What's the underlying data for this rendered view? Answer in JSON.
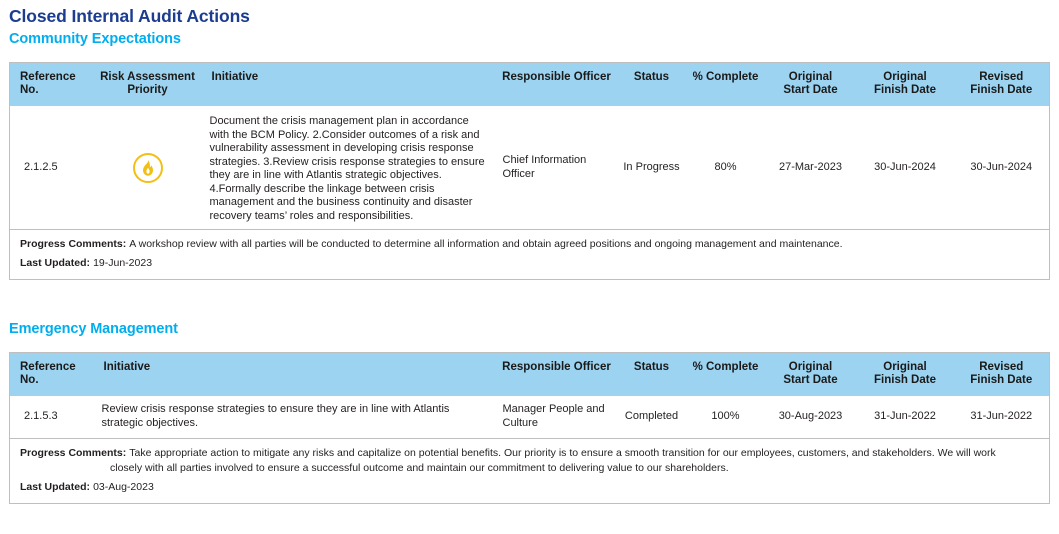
{
  "document": {
    "title": "Closed Internal Audit Actions"
  },
  "sections": [
    {
      "heading": "Community Expectations",
      "columns": {
        "reference_no": "Reference\nNo.",
        "reference_no_l1": "Reference",
        "reference_no_l2": "No.",
        "risk_priority_l1": "Risk Assessment",
        "risk_priority_l2": "Priority",
        "initiative": "Initiative",
        "responsible_officer": "Responsible Officer",
        "status": "Status",
        "percent_complete": "% Complete",
        "original_start_l1": "Original",
        "original_start_l2": "Start Date",
        "original_finish_l1": "Original",
        "original_finish_l2": "Finish Date",
        "revised_finish_l1": "Revised",
        "revised_finish_l2": "Finish Date"
      },
      "row": {
        "reference_no": "2.1.2.5",
        "risk_icon": "flame-icon",
        "risk_icon_color": "#f2c014",
        "initiative": "Document the crisis management plan in accordance with the BCM Policy. 2.Consider outcomes of a risk and vulnerability\nassessment in developing crisis response strategies. 3.Review crisis response strategies to ensure they are in line with Atlantis strategic objectives. 4.Formally describe the linkage between crisis management and the business continuity and disaster recovery teams’ roles and responsibilities.",
        "responsible_officer": "Chief Information Officer",
        "status": "In Progress",
        "percent_complete": "80%",
        "original_start_date": "27-Mar-2023",
        "original_finish_date": "30-Jun-2024",
        "revised_finish_date": "30-Jun-2024"
      },
      "footer": {
        "progress_comments_label": "Progress Comments:",
        "progress_comments_text": "A workshop review with all parties will be conducted to determine all information and obtain agreed positions and ongoing management and maintenance.",
        "progress_comments_text_cont": "",
        "last_updated_label": "Last Updated:",
        "last_updated_value": "19-Jun-2023"
      }
    },
    {
      "heading": "Emergency Management",
      "columns": {
        "reference_no_l1": "Reference",
        "reference_no_l2": "No.",
        "initiative": "Initiative",
        "responsible_officer": "Responsible Officer",
        "status": "Status",
        "percent_complete": "% Complete",
        "original_start_l1": "Original",
        "original_start_l2": "Start Date",
        "original_finish_l1": "Original",
        "original_finish_l2": "Finish Date",
        "revised_finish_l1": "Revised",
        "revised_finish_l2": "Finish Date"
      },
      "row": {
        "reference_no": "2.1.5.3",
        "initiative": "Review crisis response strategies to ensure they are in line with Atlantis strategic objectives.",
        "responsible_officer": "Manager People and Culture",
        "status": "Completed",
        "percent_complete": "100%",
        "original_start_date": "30-Aug-2023",
        "original_finish_date": "31-Jun-2022",
        "revised_finish_date": "31-Jun-2022"
      },
      "footer": {
        "progress_comments_label": "Progress Comments:",
        "progress_comments_text": "Take appropriate action to mitigate any risks and capitalize on potential benefits. Our priority is to ensure a smooth transition for our employees, customers, and stakeholders. We will work",
        "progress_comments_text_cont": "closely with all parties involved to ensure a successful outcome and maintain our commitment to delivering value to our shareholders.",
        "last_updated_label": "Last Updated:",
        "last_updated_value": "03-Aug-2023"
      }
    }
  ],
  "colors": {
    "title": "#1b3c8f",
    "section_heading": "#00aeef",
    "table_header_bg": "#9bd3f0",
    "risk_amber": "#f2c014",
    "border": "#bfbfbf"
  }
}
